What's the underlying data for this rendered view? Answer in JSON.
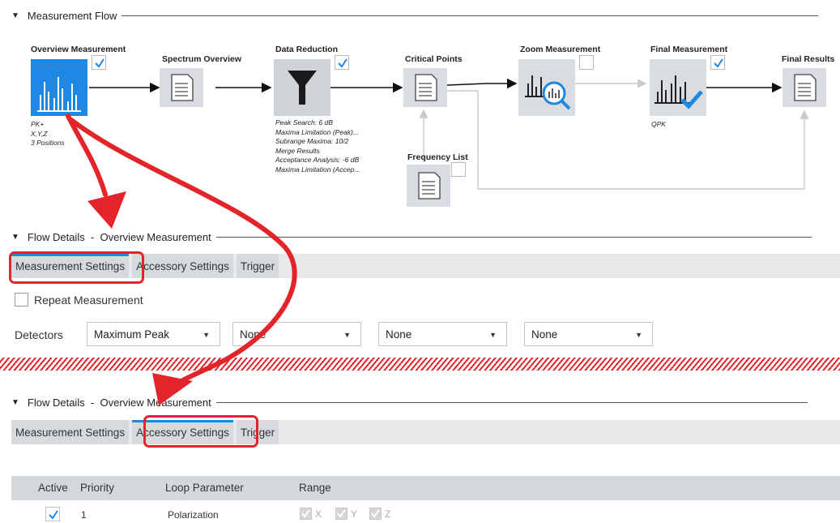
{
  "flow": {
    "header": "Measurement Flow",
    "nodes": [
      {
        "title": "Overview Measurement",
        "notes": [
          "PK+",
          "X,Y,Z",
          "3 Positions"
        ],
        "checked": true
      },
      {
        "title": "Spectrum Overview",
        "notes": [],
        "checked": false
      },
      {
        "title": "Data Reduction",
        "notes": [
          "Peak Search: 6 dB",
          "Maxima Limitation (Peak)...",
          "Subrange Maxima: 10/2",
          "Merge Results",
          "Acceptance Analysis: -6 dB",
          "Maxima Limitation (Accep..."
        ],
        "checked": true
      },
      {
        "title": "Critical Points",
        "notes": [],
        "checked": false
      },
      {
        "title": "Frequency List",
        "notes": [],
        "checked": false
      },
      {
        "title": "Zoom Measurement",
        "notes": [],
        "checked": false
      },
      {
        "title": "Final Measurement",
        "notes": [
          "QPK"
        ],
        "checked": true
      },
      {
        "title": "Final Results",
        "notes": [],
        "checked": false
      }
    ]
  },
  "details1": {
    "header": "Flow Details  -  Overview Measurement",
    "tabs": [
      "Measurement Settings",
      "Accessory Settings",
      "Trigger"
    ],
    "selected_tab": "Measurement Settings",
    "repeat_label": "Repeat Measurement",
    "detectors_label": "Detectors",
    "detectors": [
      "Maximum Peak",
      "None",
      "None",
      "None"
    ]
  },
  "details2": {
    "header": "Flow Details  -  Overview Measurement",
    "tabs": [
      "Measurement Settings",
      "Accessory Settings",
      "Trigger"
    ],
    "selected_tab": "Accessory Settings",
    "table": {
      "columns": [
        "Active",
        "Priority",
        "Loop Parameter",
        "Range"
      ],
      "rows": [
        {
          "active": true,
          "priority": "1",
          "loop_parameter": "Polarization",
          "range": [
            "X",
            "Y",
            "Z"
          ]
        }
      ]
    }
  },
  "colors": {
    "accent": "#1e88e5",
    "annotation_red": "#e3242b"
  }
}
